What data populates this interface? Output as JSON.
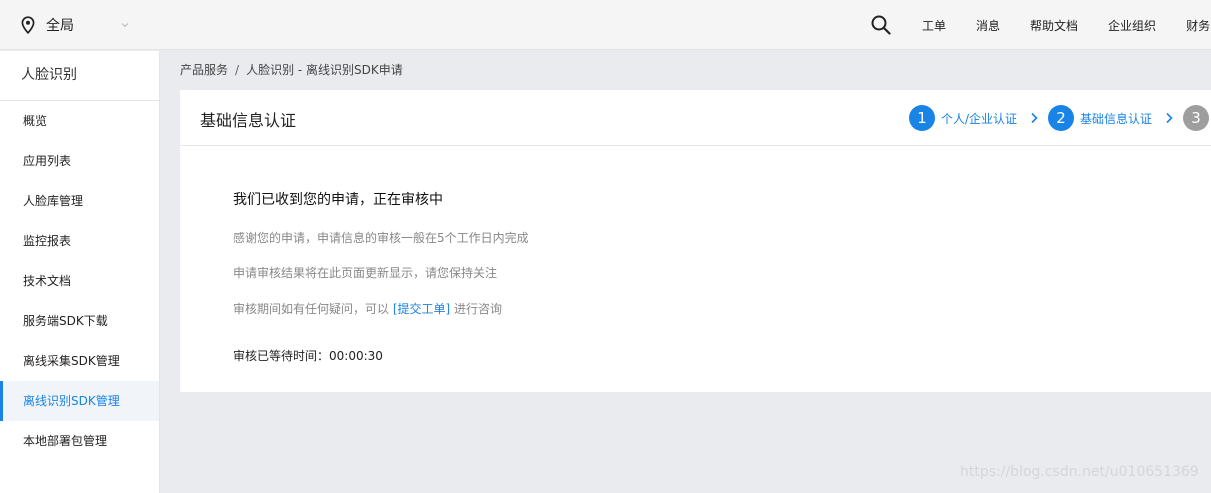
{
  "topbar": {
    "region": "全局",
    "nav": [
      "工单",
      "消息",
      "帮助文档",
      "企业组织",
      "财务"
    ]
  },
  "sidebar": {
    "title": "人脸识别",
    "items": [
      {
        "label": "概览"
      },
      {
        "label": "应用列表"
      },
      {
        "label": "人脸库管理"
      },
      {
        "label": "监控报表"
      },
      {
        "label": "技术文档"
      },
      {
        "label": "服务端SDK下载"
      },
      {
        "label": "离线采集SDK管理"
      },
      {
        "label": "离线识别SDK管理",
        "active": true
      },
      {
        "label": "本地部署包管理"
      }
    ]
  },
  "breadcrumb": {
    "root": "产品服务",
    "sep": "/",
    "current": "人脸识别 - 离线识别SDK申请"
  },
  "card": {
    "title": "基础信息认证",
    "steps": [
      {
        "num": "1",
        "label": "个人/企业认证"
      },
      {
        "num": "2",
        "label": "基础信息认证"
      },
      {
        "num": "3",
        "label": ""
      }
    ]
  },
  "message": {
    "title": "我们已收到您的申请，正在审核中",
    "line1": "感谢您的申请，申请信息的审核一般在5个工作日内完成",
    "line2": "申请审核结果将在此页面更新显示，请您保持关注",
    "line3_prefix": "审核期间如有任何疑问，可以 ",
    "line3_link": "[提交工单]",
    "line3_suffix": " 进行咨询",
    "wait_label": "审核已等待时间：",
    "wait_time": "00:00:30"
  },
  "watermark": "https://blog.csdn.net/u010651369",
  "colors": {
    "accent": "#1a83e6",
    "step_inactive": "#9e9e9e"
  }
}
